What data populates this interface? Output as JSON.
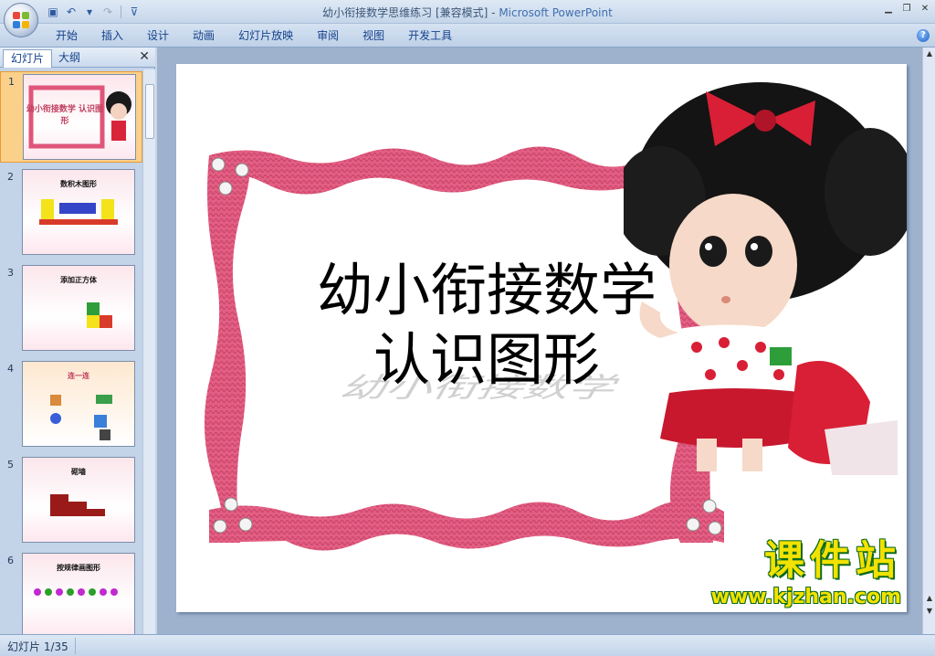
{
  "window": {
    "title_doc": "幼小衔接数学思维练习 [兼容模式] - ",
    "title_app": "Microsoft PowerPoint"
  },
  "ribbon": {
    "tabs": [
      "开始",
      "插入",
      "设计",
      "动画",
      "幻灯片放映",
      "审阅",
      "视图",
      "开发工具"
    ]
  },
  "panel": {
    "tab_slides": "幻灯片",
    "tab_outline": "大纲"
  },
  "thumbnails": [
    {
      "num": "1",
      "caption": "幼小衔接数学 认识图形"
    },
    {
      "num": "2",
      "caption": "数积木图形"
    },
    {
      "num": "3",
      "caption": "添加正方体"
    },
    {
      "num": "4",
      "caption": "连一连"
    },
    {
      "num": "5",
      "caption": "砌墙"
    },
    {
      "num": "6",
      "caption": "按规律画图形"
    }
  ],
  "slide": {
    "title_line1": "幼小衔接数学",
    "title_line2": "认识图形",
    "watermark_cn": "课件站",
    "watermark_url": "www.kjzhan.com"
  },
  "status": {
    "slide_counter": "幻灯片 1/35"
  },
  "colors": {
    "frame_pink": "#e0557a",
    "ribbon_text": "#15428b",
    "selection": "#fbd08a"
  }
}
